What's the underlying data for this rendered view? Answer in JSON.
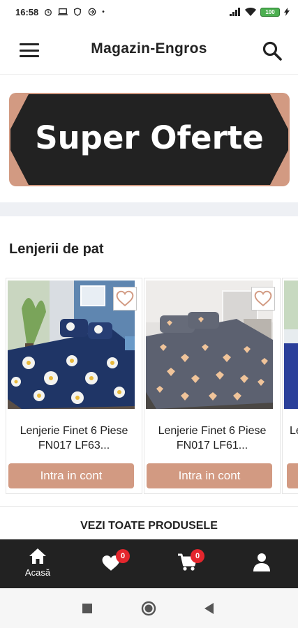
{
  "status_bar": {
    "time": "16:58",
    "battery": "100"
  },
  "header": {
    "title": "Magazin-Engros"
  },
  "banner": {
    "text": "Super Oferte"
  },
  "section": {
    "title": "Lenjerii de pat"
  },
  "products": [
    {
      "name_line1": "Lenjerie Finet 6 Piese",
      "name_line2": "FN017  LF63...",
      "button": "Intra in cont"
    },
    {
      "name_line1": "Lenjerie Finet 6 Piese",
      "name_line2": "FN017 LF61...",
      "button": "Intra in cont"
    },
    {
      "name_line1": "Le",
      "name_line2": "",
      "button": ""
    }
  ],
  "see_all": {
    "label": "VEZI TOATE PRODUSELE"
  },
  "bottom_nav": {
    "home_label": "Acasă",
    "favorites_count": "0",
    "cart_count": "0"
  },
  "colors": {
    "accent": "#d29a82",
    "nav_bg": "#222222",
    "badge": "#e4262d"
  },
  "icons": [
    "menu-icon",
    "search-icon",
    "heart-icon",
    "home-icon",
    "cart-icon",
    "user-icon"
  ]
}
